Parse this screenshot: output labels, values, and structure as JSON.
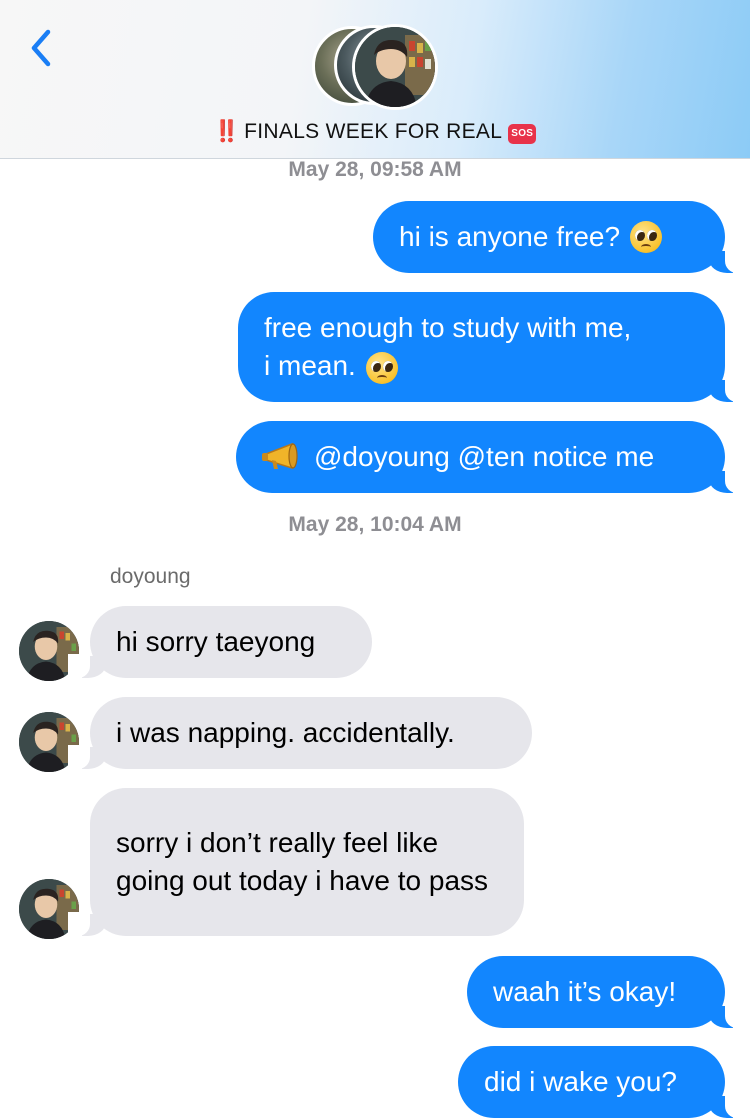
{
  "header": {
    "title_prefix": "‼️",
    "title": "FINALS WEEK FOR REAL",
    "title_badge": "SOS"
  },
  "conversation": {
    "timestamp_1": "May 28, 09:58 AM",
    "timestamp_2": "May 28, 10:04 AM",
    "sender_name": "doyoung",
    "messages": [
      {
        "direction": "outgoing",
        "text": "hi is anyone free?",
        "emoji": "pleading-face"
      },
      {
        "direction": "outgoing",
        "text": "free enough to study with me,\ni mean.",
        "emoji": "pleading-face"
      },
      {
        "direction": "outgoing",
        "text": "@doyoung @ten notice me",
        "emoji": "megaphone"
      },
      {
        "direction": "incoming",
        "text": "hi sorry taeyong"
      },
      {
        "direction": "incoming",
        "text": "i was napping. accidentally."
      },
      {
        "direction": "incoming",
        "text": "sorry i don’t really feel like going out today i have to pass"
      },
      {
        "direction": "outgoing",
        "text": "waah it’s okay!"
      },
      {
        "direction": "outgoing",
        "text": "did i wake you?"
      }
    ]
  },
  "colors": {
    "outgoing_bubble": "#1286fe",
    "incoming_bubble": "#e6e6eb",
    "timestamp": "#8e8e93",
    "back_chevron": "#1a7ef5"
  }
}
